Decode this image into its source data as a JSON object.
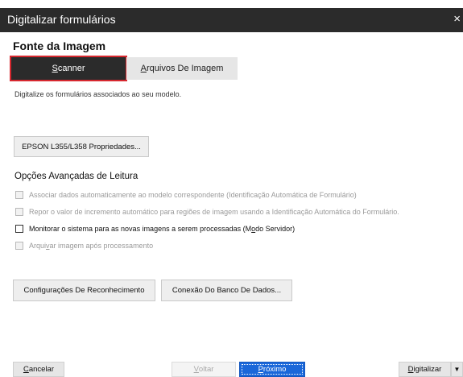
{
  "window": {
    "title": "Digitalizar formulários",
    "close_glyph": "×"
  },
  "source": {
    "title": "Fonte da Imagem",
    "tabs": [
      {
        "label_first": "S",
        "label_rest": "canner",
        "selected": true
      },
      {
        "label_first": "A",
        "label_rest": "rquivos De Imagem",
        "selected": false
      }
    ],
    "description": "Digitalize os formulários associados ao seu modelo."
  },
  "scanner_properties_button": "EPSON L355/L358 Propriedades...",
  "advanced": {
    "title": "Opções Avançadas de Leitura",
    "options": [
      {
        "label": "Associar dados automaticamente ao modelo correspondente (Identificação Automática de Formulário)",
        "checked": false,
        "enabled": false
      },
      {
        "label": "Repor o valor de incremento automático para regiões de imagem usando a Identificação Automática do Formulário.",
        "checked": false,
        "enabled": false
      },
      {
        "label_pre": "Monitorar o sistema para as novas imagens a serem processadas (M",
        "label_u": "o",
        "label_post": "do Servidor)",
        "checked": false,
        "enabled": true
      },
      {
        "label_pre": "Arqui",
        "label_u": "v",
        "label_post": "ar imagem após processamento",
        "checked": false,
        "enabled": false
      }
    ]
  },
  "buttons": {
    "recognition_settings": "Configurações De Reconhecimento",
    "database_connection": "Conexão Do Banco De Dados..."
  },
  "footer": {
    "cancel_first": "C",
    "cancel_rest": "ancelar",
    "back_first": "V",
    "back_rest": "oltar",
    "next_first": "P",
    "next_rest": "róximo",
    "scan_first": "D",
    "scan_rest": "igitalizar",
    "dropdown_glyph": "▼"
  },
  "colors": {
    "titlebar": "#2b2b2b",
    "selected_tab": "#2b2b2b",
    "selected_tab_outline": "#d7282f",
    "primary_button": "#1a67d9"
  }
}
